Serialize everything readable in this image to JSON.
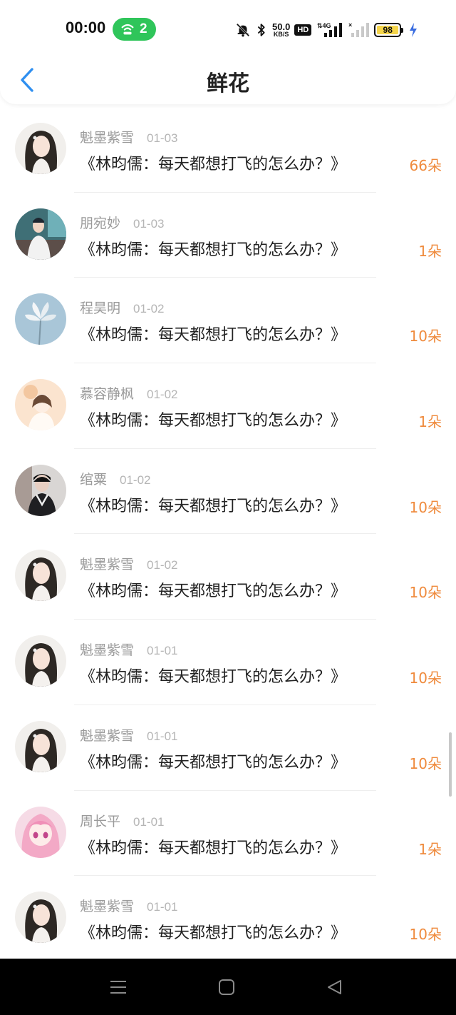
{
  "status_bar": {
    "time": "00:00",
    "hotspot_count": "2",
    "net_speed_value": "50.0",
    "net_speed_unit": "KB/S",
    "hd_label": "HD",
    "battery_level": "98",
    "icons": [
      "mute-bell-icon",
      "bluetooth-icon",
      "4g-signal-icon",
      "signal-bars-icon",
      "battery-icon",
      "charging-icon"
    ]
  },
  "title_bar": {
    "title": "鲜花",
    "back_icon": "back-chevron-icon"
  },
  "colors": {
    "accent": "#2f8ff0",
    "flower_count": "#ef8a3c",
    "hotspot": "#2fc55a"
  },
  "records": [
    {
      "name": "魁墨紫雪",
      "date": "01-03",
      "article": "《林昀儒：每天都想打飞的怎么办？》",
      "flowers": "66朵",
      "avatar": "avatar-girl-long-hair"
    },
    {
      "name": "朋宛妙",
      "date": "01-03",
      "article": "《林昀儒：每天都想打飞的怎么办？》",
      "flowers": "1朵",
      "avatar": "avatar-boy-teal"
    },
    {
      "name": "程昊明",
      "date": "01-02",
      "article": "《林昀儒：每天都想打飞的怎么办？》",
      "flowers": "10朵",
      "avatar": "avatar-white-flower"
    },
    {
      "name": "慕容静枫",
      "date": "01-02",
      "article": "《林昀儒：每天都想打飞的怎么办？》",
      "flowers": "1朵",
      "avatar": "avatar-cartoon-girl"
    },
    {
      "name": "绾粟",
      "date": "01-02",
      "article": "《林昀儒：每天都想打飞的怎么办？》",
      "flowers": "10朵",
      "avatar": "avatar-boy-dark"
    },
    {
      "name": "魁墨紫雪",
      "date": "01-02",
      "article": "《林昀儒：每天都想打飞的怎么办？》",
      "flowers": "10朵",
      "avatar": "avatar-girl-long-hair"
    },
    {
      "name": "魁墨紫雪",
      "date": "01-01",
      "article": "《林昀儒：每天都想打飞的怎么办？》",
      "flowers": "10朵",
      "avatar": "avatar-girl-long-hair"
    },
    {
      "name": "魁墨紫雪",
      "date": "01-01",
      "article": "《林昀儒：每天都想打飞的怎么办？》",
      "flowers": "10朵",
      "avatar": "avatar-girl-long-hair"
    },
    {
      "name": "周长平",
      "date": "01-01",
      "article": "《林昀儒：每天都想打飞的怎么办？》",
      "flowers": "1朵",
      "avatar": "avatar-anime-pink"
    },
    {
      "name": "魁墨紫雪",
      "date": "01-01",
      "article": "《林昀儒：每天都想打飞的怎么办？》",
      "flowers": "10朵",
      "avatar": "avatar-girl-long-hair"
    }
  ],
  "nav_bar": {
    "items": [
      "menu-icon",
      "home-square-icon",
      "back-triangle-icon"
    ]
  }
}
